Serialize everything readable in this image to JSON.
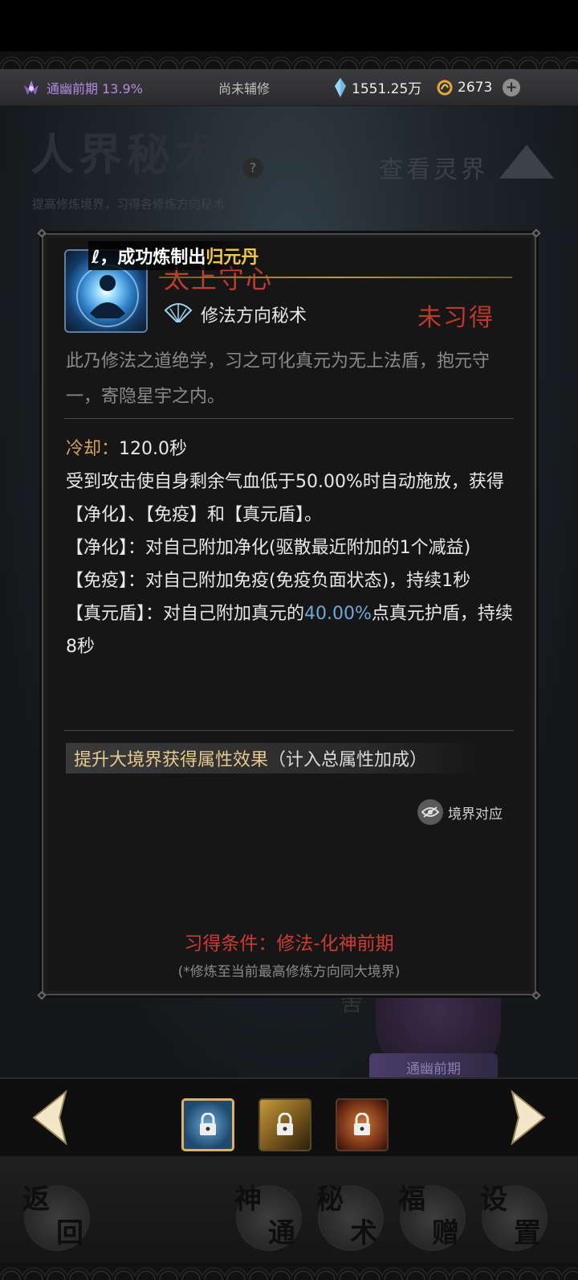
{
  "status": {
    "realm": "通幽前期 13.9%",
    "assist": "尚未辅修",
    "spirit_stones": "1551.25万",
    "coins": "2673",
    "plus_label": "+"
  },
  "background": {
    "title": "人界秘术",
    "help": "?",
    "subtitle": "提高修炼境界，习得各修炼方向秘术",
    "view_spirit": "查看灵界",
    "behind_seat": "舍",
    "behind_label": "通幽前期"
  },
  "toast": {
    "prefix": "ℓ，成功炼制出",
    "item": "归元丹"
  },
  "skill": {
    "name": "太上守心",
    "type": "修法方向秘术",
    "status": "未习得",
    "description": "此乃修法之道绝学，习之可化真元为无上法盾，抱元守一，寄隐星宇之内。",
    "cooldown_label": "冷却：",
    "cooldown_value": "120.0秒",
    "effect_line1": "受到攻击使自身剩余气血低于50.00%时自动施放，获得【净化】、【免疫】和【真元盾】。",
    "effect_purify": "【净化】：对自己附加净化(驱散最近附加的1个减益)",
    "effect_immune": "【免疫】：对自己附加免疫(免疫负面状态)，持续1秒",
    "effect_shield_a": "【真元盾】：对自己附加真元的",
    "effect_shield_pct": "40.00%",
    "effect_shield_b": "点真元护盾，持续8秒",
    "upgrade_gold": "提升大境界获得属性效果",
    "upgrade_gray": "（计入总属性加成）",
    "realm_match": "境界对应",
    "condition": "习得条件：修法-化神前期",
    "condition_note": "(*修炼至当前最高修炼方向同大境界)"
  },
  "nav": {
    "back": [
      "返",
      "回"
    ],
    "divine": [
      "神",
      "通"
    ],
    "secret": [
      "秘",
      "术"
    ],
    "blessing": [
      "福",
      "赠"
    ],
    "settings": [
      "设",
      "置"
    ]
  },
  "colors": {
    "accent_gold": "#e5c98e",
    "status_red": "#c3362a",
    "realm_purple": "#b48ae6",
    "highlight_blue": "#6fa8d8"
  }
}
